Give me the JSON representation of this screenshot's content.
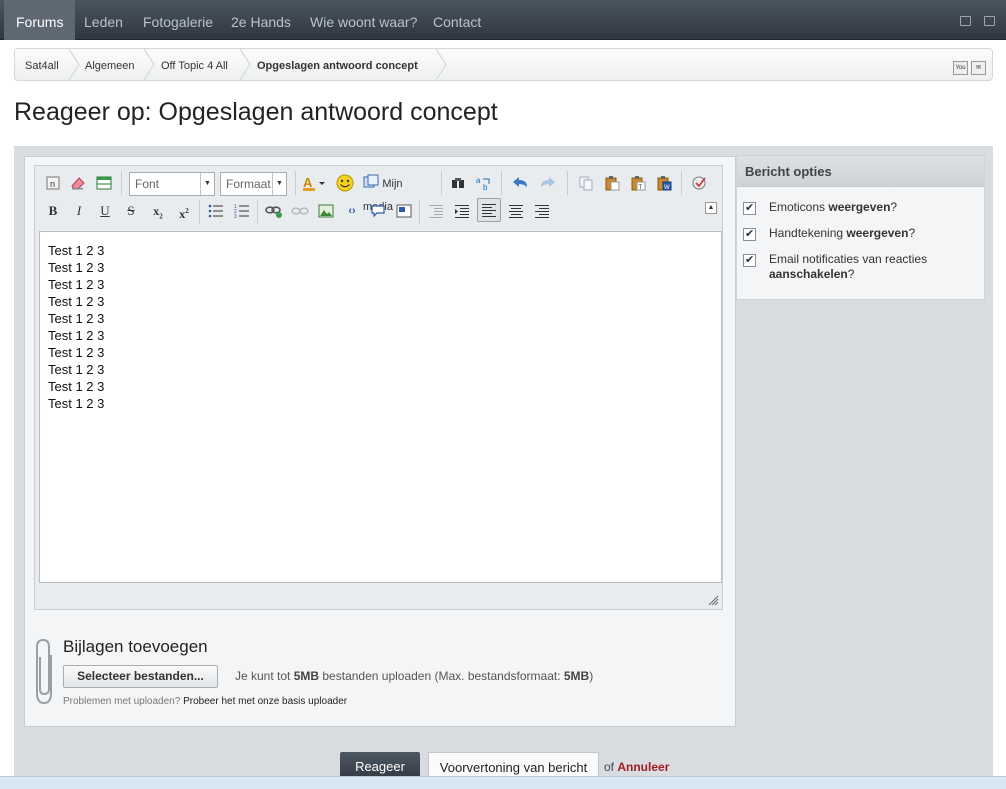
{
  "nav": {
    "tabs": [
      "Forums",
      "Leden",
      "Fotogalerie",
      "2e Hands",
      "Wie woont waar?",
      "Contact"
    ],
    "active": "Forums"
  },
  "breadcrumb": [
    "Sat4all",
    "Algemeen",
    "Off Topic 4 All",
    "Opgeslagen antwoord concept"
  ],
  "page_title": "Reageer op: Opgeslagen antwoord concept",
  "toolbar": {
    "font_label": "Font",
    "format_label": "Formaat",
    "media_label": "Mijn media"
  },
  "editor": {
    "lines": [
      "Test 1 2 3",
      "Test 1 2 3",
      "Test 1 2 3",
      "Test 1 2 3",
      "Test 1 2 3",
      "Test 1 2 3",
      "Test 1 2 3",
      "Test 1 2 3",
      "Test 1 2 3",
      "Test 1 2 3"
    ]
  },
  "options": {
    "title": "Bericht opties",
    "items": [
      {
        "pre": "Emoticons ",
        "bold": "weergeven",
        "post": "?",
        "checked": true
      },
      {
        "pre": "Handtekening ",
        "bold": "weergeven",
        "post": "?",
        "checked": true
      },
      {
        "pre": "Email notificaties van reacties ",
        "bold": "aanschakelen",
        "post": "?",
        "checked": true
      }
    ]
  },
  "attachments": {
    "title": "Bijlagen toevoegen",
    "select_button": "Selecteer bestanden...",
    "info_pre": "Je kunt tot ",
    "info_size": "5MB",
    "info_mid": " bestanden uploaden (Max. bestandsformaat: ",
    "info_max": "5MB",
    "info_post": ")",
    "problem_text": "Problemen met uploaden?",
    "problem_link": "Probeer het met onze basis uploader"
  },
  "footer": {
    "reply_button": "Reageer",
    "preview_button": "Voorvertoning van bericht",
    "or_text": "of",
    "cancel_link": "Annuleer"
  }
}
